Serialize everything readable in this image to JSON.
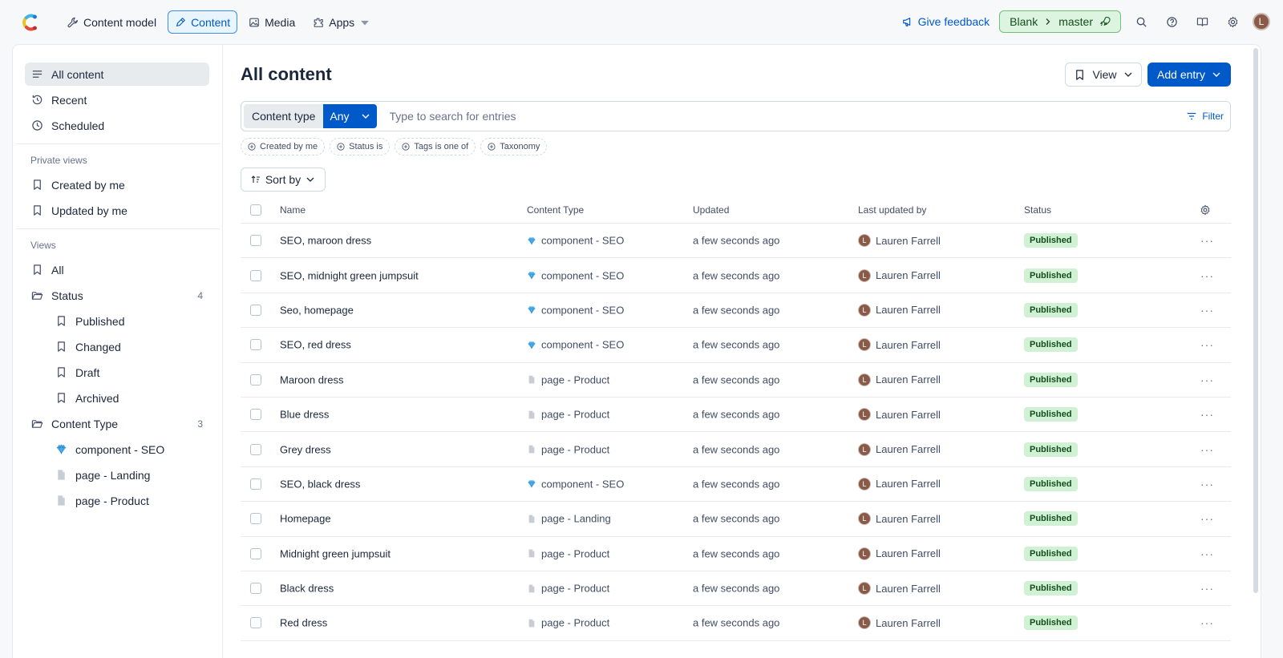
{
  "topbar": {
    "nav": [
      {
        "label": "Content model",
        "icon": "wrench-icon"
      },
      {
        "label": "Content",
        "icon": "pen-icon",
        "active": true
      },
      {
        "label": "Media",
        "icon": "image-icon"
      },
      {
        "label": "Apps",
        "icon": "puzzle-icon"
      }
    ],
    "feedback": "Give feedback",
    "env_space": "Blank",
    "env_branch": "master",
    "avatar_initial": "L"
  },
  "sidebar": {
    "top_items": [
      {
        "label": "All content",
        "icon": "list-icon"
      },
      {
        "label": "Recent",
        "icon": "history-icon"
      },
      {
        "label": "Scheduled",
        "icon": "clock-icon"
      }
    ],
    "private_heading": "Private views",
    "private_items": [
      {
        "label": "Created by me"
      },
      {
        "label": "Updated by me"
      }
    ],
    "views_heading": "Views",
    "views": {
      "all": "All",
      "status_label": "Status",
      "status_count": "4",
      "status_items": [
        "Published",
        "Changed",
        "Draft",
        "Archived"
      ],
      "ctype_label": "Content Type",
      "ctype_count": "3",
      "ctype_items": [
        "component - SEO",
        "page - Landing",
        "page - Product"
      ]
    }
  },
  "main": {
    "title": "All content",
    "view_label": "View",
    "add_label": "Add entry",
    "search": {
      "content_type_label": "Content type",
      "content_type_value": "Any",
      "placeholder": "Type to search for entries",
      "filter_label": "Filter"
    },
    "chips": [
      "Created by me",
      "Status is",
      "Tags is one of",
      "Taxonomy"
    ],
    "sort_label": "Sort by",
    "columns": [
      "Name",
      "Content Type",
      "Updated",
      "Last updated by",
      "Status"
    ],
    "rows": [
      {
        "name": "SEO, maroon dress",
        "type": "component - SEO",
        "kind": "gem",
        "updated": "a few seconds ago",
        "by": "Lauren Farrell",
        "status": "Published"
      },
      {
        "name": "SEO, midnight green jumpsuit",
        "type": "component - SEO",
        "kind": "gem",
        "updated": "a few seconds ago",
        "by": "Lauren Farrell",
        "status": "Published"
      },
      {
        "name": "Seo, homepage",
        "type": "component - SEO",
        "kind": "gem",
        "updated": "a few seconds ago",
        "by": "Lauren Farrell",
        "status": "Published"
      },
      {
        "name": "SEO, red dress",
        "type": "component - SEO",
        "kind": "gem",
        "updated": "a few seconds ago",
        "by": "Lauren Farrell",
        "status": "Published"
      },
      {
        "name": "Maroon dress",
        "type": "page - Product",
        "kind": "doc",
        "updated": "a few seconds ago",
        "by": "Lauren Farrell",
        "status": "Published"
      },
      {
        "name": "Blue dress",
        "type": "page - Product",
        "kind": "doc",
        "updated": "a few seconds ago",
        "by": "Lauren Farrell",
        "status": "Published"
      },
      {
        "name": "Grey dress",
        "type": "page - Product",
        "kind": "doc",
        "updated": "a few seconds ago",
        "by": "Lauren Farrell",
        "status": "Published"
      },
      {
        "name": "SEO, black dress",
        "type": "component - SEO",
        "kind": "gem",
        "updated": "a few seconds ago",
        "by": "Lauren Farrell",
        "status": "Published"
      },
      {
        "name": "Homepage",
        "type": "page - Landing",
        "kind": "doc",
        "updated": "a few seconds ago",
        "by": "Lauren Farrell",
        "status": "Published"
      },
      {
        "name": "Midnight green jumpsuit",
        "type": "page - Product",
        "kind": "doc",
        "updated": "a few seconds ago",
        "by": "Lauren Farrell",
        "status": "Published"
      },
      {
        "name": "Black dress",
        "type": "page - Product",
        "kind": "doc",
        "updated": "a few seconds ago",
        "by": "Lauren Farrell",
        "status": "Published"
      },
      {
        "name": "Red dress",
        "type": "page - Product",
        "kind": "doc",
        "updated": "a few seconds ago",
        "by": "Lauren Farrell",
        "status": "Published"
      }
    ],
    "row_avatar_initial": "L",
    "more_glyph": "···"
  },
  "colors": {
    "accent": "#0059c8",
    "published_bg": "#d0f1d4",
    "env_bg": "#ddf4e0"
  }
}
